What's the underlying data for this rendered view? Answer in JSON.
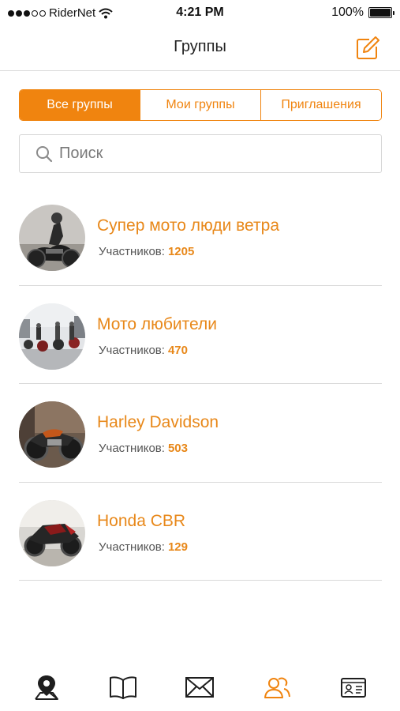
{
  "status_bar": {
    "carrier": "RiderNet",
    "time": "4:21 PM",
    "battery": "100%",
    "battery_level": 1.0
  },
  "header": {
    "title": "Группы",
    "compose_icon": "compose-icon"
  },
  "tabs_segment": [
    {
      "label": "Все группы",
      "active": true
    },
    {
      "label": "Мои группы",
      "active": false
    },
    {
      "label": "Приглашения",
      "active": false
    }
  ],
  "search": {
    "placeholder": "Поиск",
    "value": ""
  },
  "members_label": "Участников:",
  "groups": [
    {
      "name": "Супер мото люди ветра",
      "members": "1205"
    },
    {
      "name": "Мото любители",
      "members": "470"
    },
    {
      "name": "Harley Davidson",
      "members": "503"
    },
    {
      "name": "Honda CBR",
      "members": "129"
    }
  ],
  "tab_bar": [
    {
      "icon": "map-pin-icon",
      "active": false
    },
    {
      "icon": "book-icon",
      "active": false
    },
    {
      "icon": "envelope-icon",
      "active": false
    },
    {
      "icon": "groups-icon",
      "active": true
    },
    {
      "icon": "contact-card-icon",
      "active": false
    }
  ],
  "colors": {
    "accent": "#f0840f",
    "text_accent": "#e8881a",
    "divider": "#d9d9d9"
  }
}
